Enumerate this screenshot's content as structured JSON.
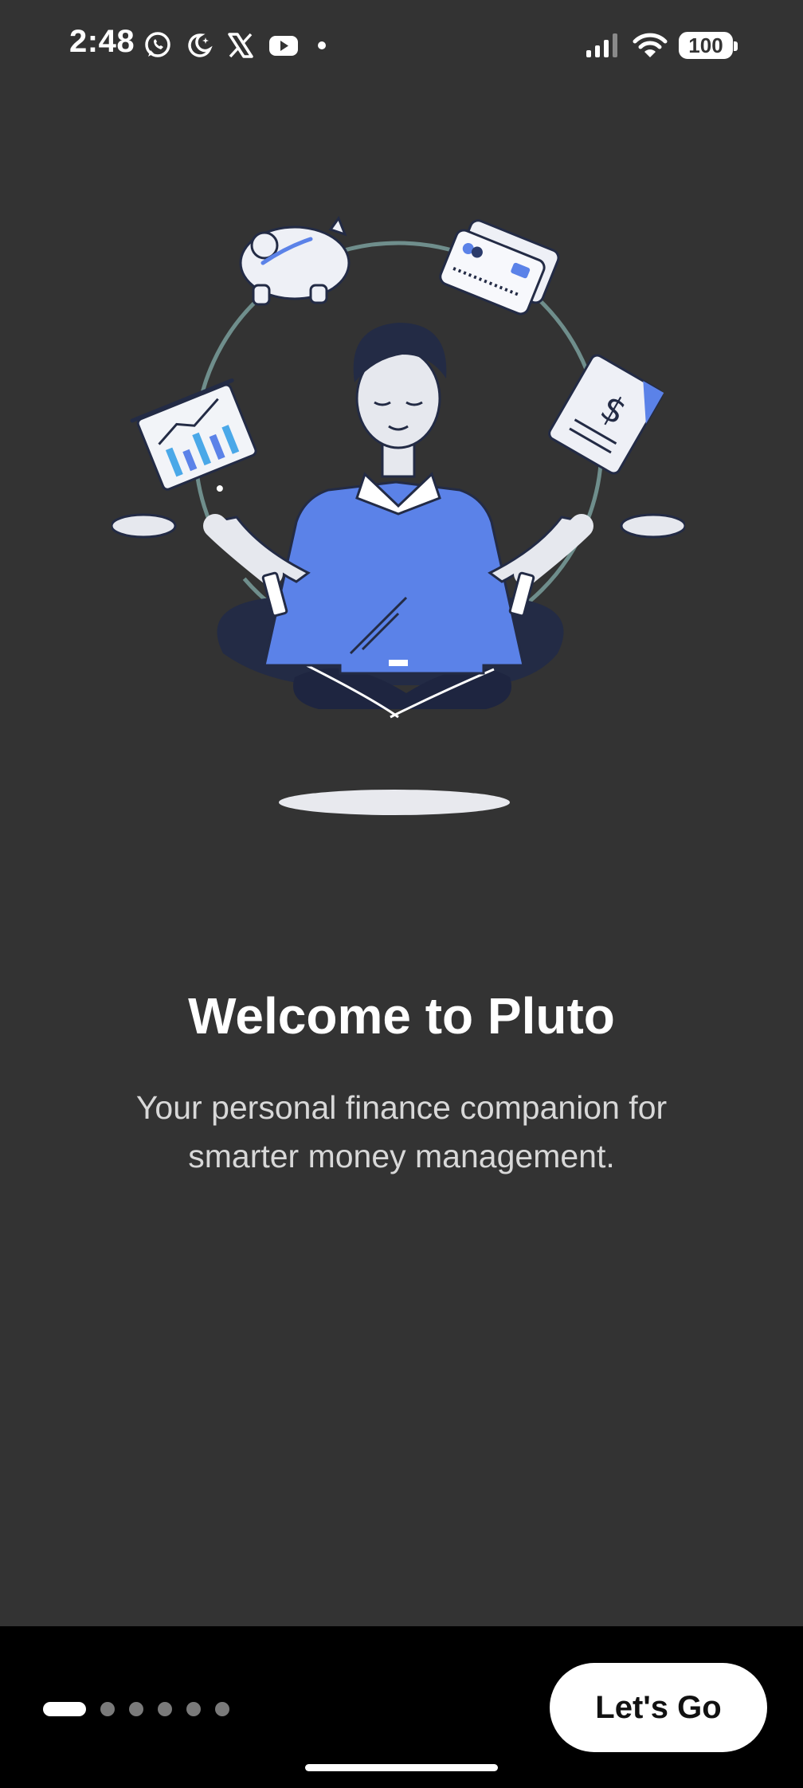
{
  "status_bar": {
    "time": "2:48",
    "left_icons": [
      "whatsapp-icon",
      "moon-icon",
      "x-icon",
      "youtube-icon",
      "dot-icon"
    ],
    "right_icons": [
      "signal-icon",
      "wifi-icon",
      "battery-icon"
    ],
    "battery": "100"
  },
  "onboarding": {
    "title": "Welcome to Pluto",
    "subtitle": "Your personal finance companion for smarter money management.",
    "illustration_icons": [
      "piggy-bank-icon",
      "credit-card-icon",
      "document-dollar-icon",
      "chart-board-icon"
    ]
  },
  "footer": {
    "pages_total": 6,
    "current_page": 1,
    "cta_label": "Let's Go"
  },
  "colors": {
    "background": "#333333",
    "bottom_bar": "#000000",
    "accent_blue": "#5b82e8",
    "navy": "#232b45"
  }
}
